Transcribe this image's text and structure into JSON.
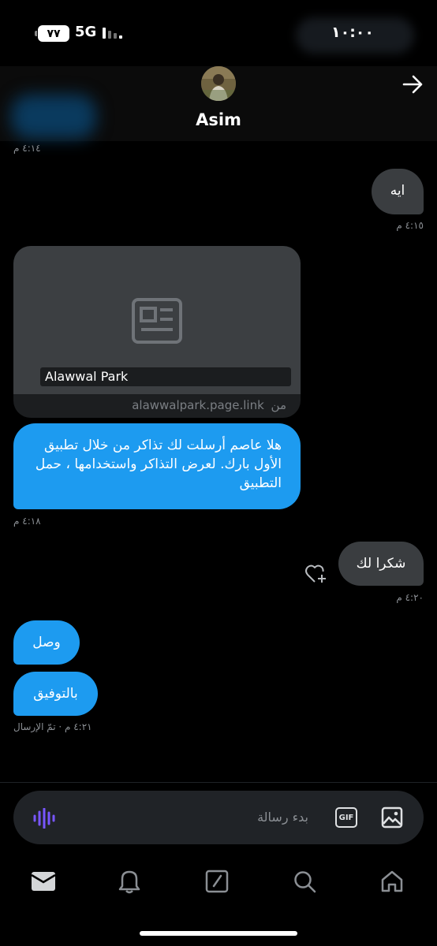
{
  "status_bar": {
    "time": "١٠:٠٠",
    "network": "5G",
    "battery": "٧٧"
  },
  "header": {
    "contact_name": "Asim",
    "back_icon": "arrow-right-icon",
    "avatar_icon": "avatar"
  },
  "messages": [
    {
      "type": "timestamp",
      "text": "٤:١٤ م"
    },
    {
      "type": "bubble",
      "direction": "outgoing",
      "text": "ايه"
    },
    {
      "type": "timestamp",
      "text": "٤:١٥ م"
    },
    {
      "type": "link_card",
      "title": "Alawwal Park",
      "url": "alawwalpark.page.link",
      "from_label": "من",
      "icon": "article-icon"
    },
    {
      "type": "bubble",
      "direction": "incoming",
      "text": "هلا عاصم أرسلت لك تذاكر من خلال تطبيق الأول بارك. لعرض التذاكر واستخدامها ، حمل التطبيق"
    },
    {
      "type": "timestamp",
      "text": "٤:١٨ م"
    },
    {
      "type": "bubble",
      "direction": "outgoing",
      "text": "شكرا لك"
    },
    {
      "type": "timestamp",
      "text": "٤:٢٠ م"
    },
    {
      "type": "bubble",
      "direction": "incoming",
      "text": "وصل"
    },
    {
      "type": "bubble",
      "direction": "incoming",
      "text": "بالتوفيق"
    },
    {
      "type": "timestamp",
      "text": "٤:٢١ م · تمّ الإرسال"
    }
  ],
  "composer": {
    "placeholder": "بدء رسالة",
    "gif_label": "GIF",
    "icons": [
      "voice-icon",
      "gif-icon",
      "image-icon"
    ]
  },
  "tab_bar": {
    "items": [
      "mail-icon",
      "bell-icon",
      "compose-icon",
      "search-icon",
      "home-icon"
    ],
    "active": "mail-icon"
  },
  "colors": {
    "incoming_bubble": "#1d9bf0",
    "outgoing_bubble": "#3a3d40",
    "background": "#000000",
    "voice_accent": "#7856ff"
  }
}
